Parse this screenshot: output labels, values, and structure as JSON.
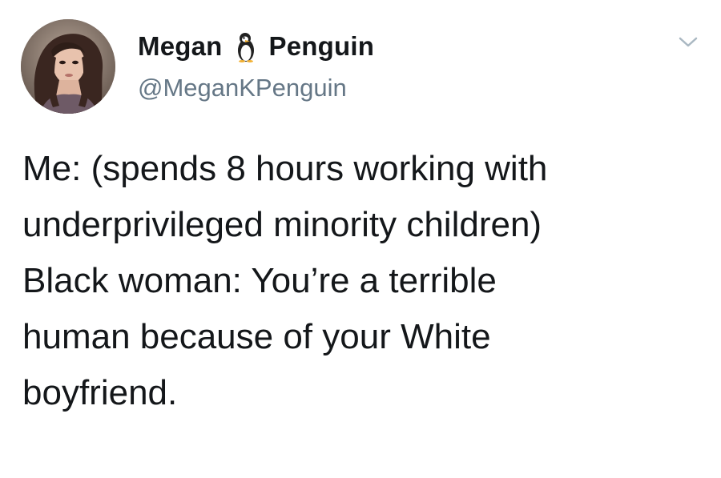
{
  "tweet": {
    "author": {
      "display_name_first": "Megan",
      "display_name_last": "Penguin",
      "name_emoji": "penguin-icon",
      "handle": "@MeganKPenguin",
      "avatar": "profile-photo"
    },
    "menu_icon": "chevron-down-icon",
    "text_lines": [
      "Me: (spends 8 hours working with",
      "underprivileged minority children)",
      "Black woman: You’re a terrible",
      "human because of your White",
      "boyfriend."
    ]
  },
  "colors": {
    "text": "#14171a",
    "secondary_text": "#657786",
    "caret": "#aab8c2",
    "background": "#ffffff"
  }
}
